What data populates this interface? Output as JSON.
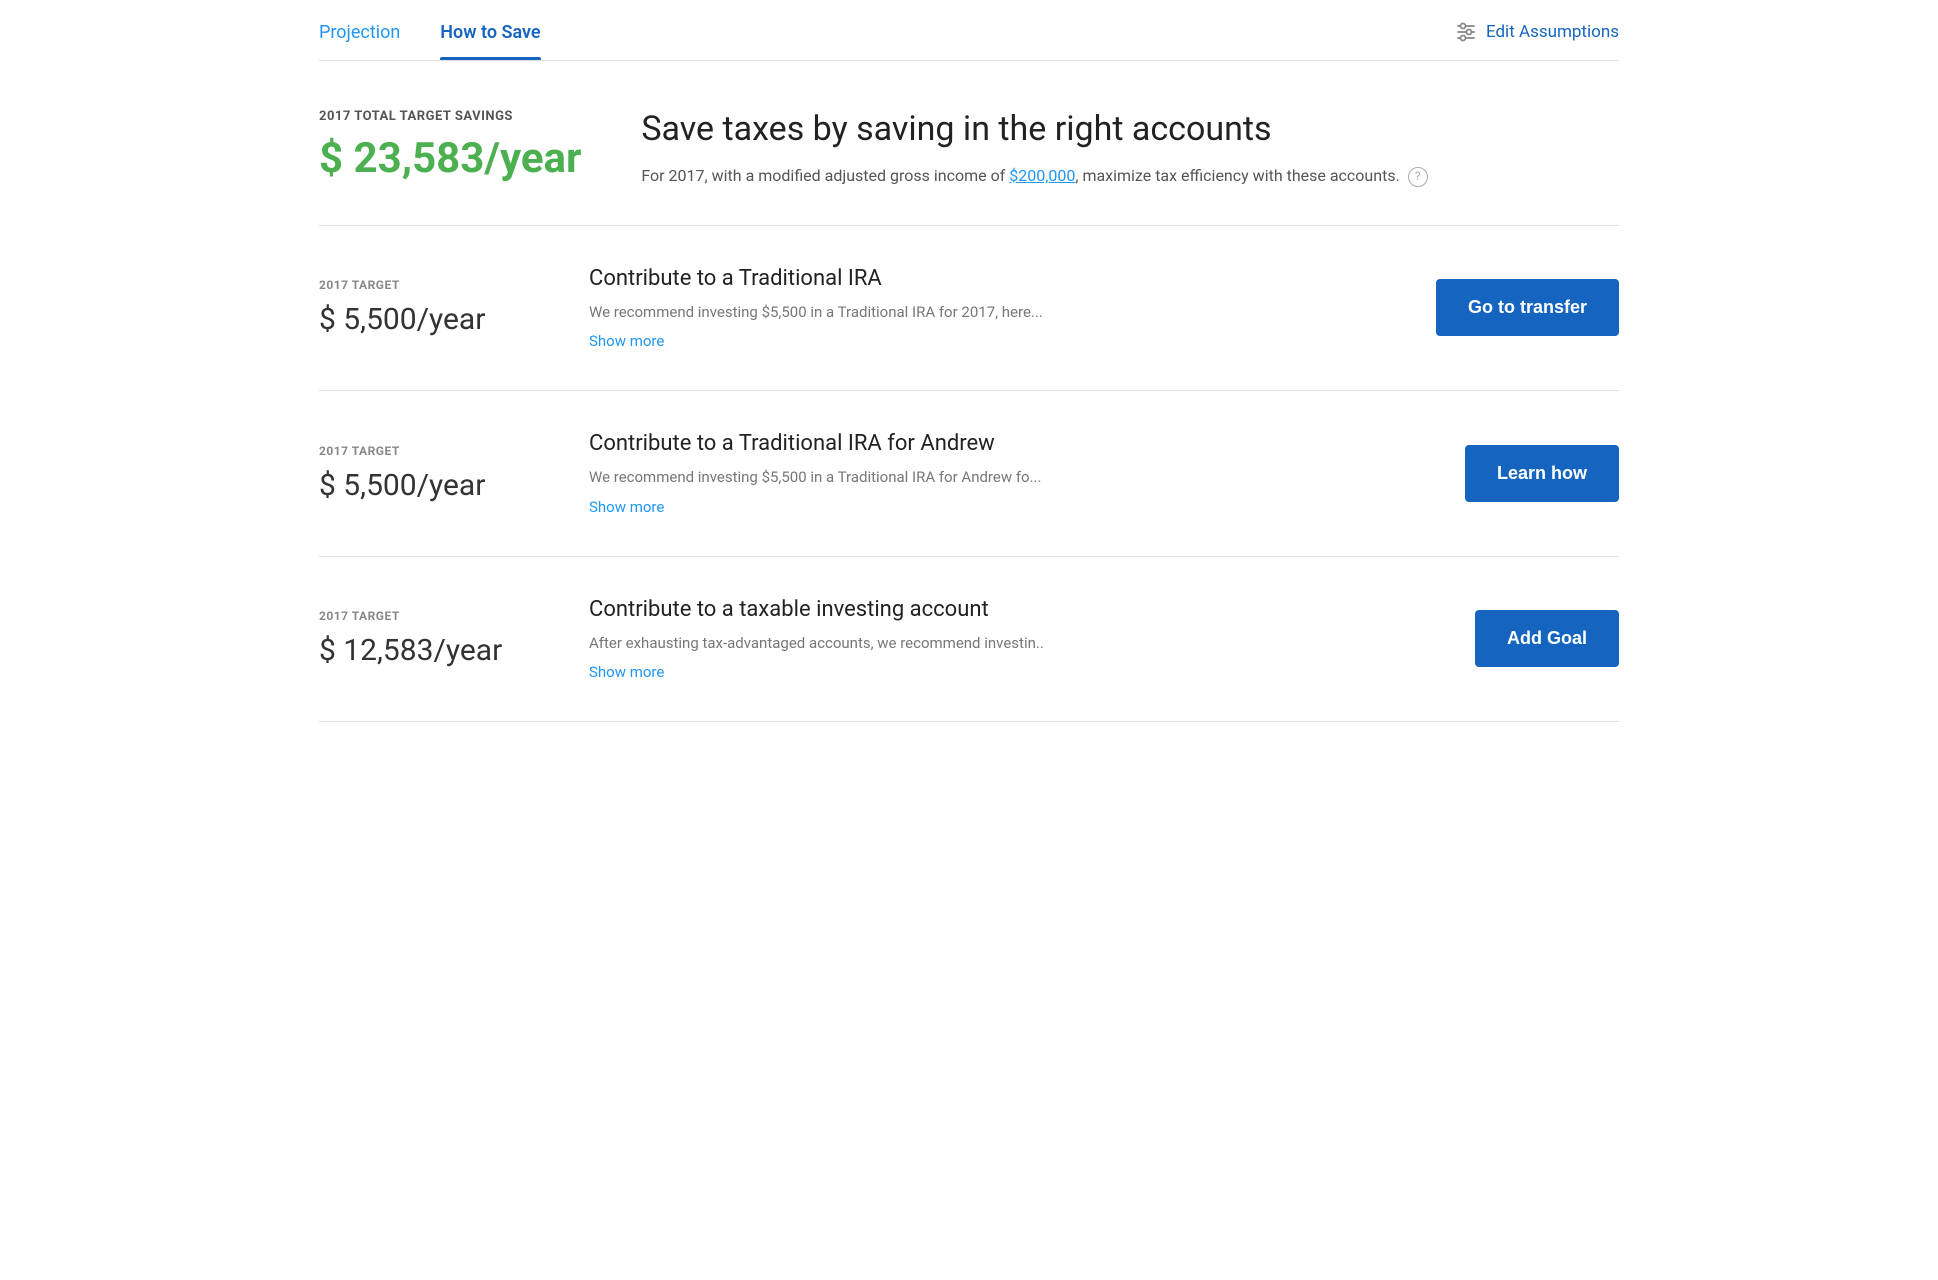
{
  "tabs": {
    "projection": {
      "label": "Projection",
      "active": false
    },
    "how_to_save": {
      "label": "How to Save",
      "active": true
    }
  },
  "header": {
    "edit_assumptions_label": "Edit Assumptions"
  },
  "hero": {
    "label": "2017 TOTAL TARGET SAVINGS",
    "amount": "$ 23,583/year",
    "title": "Save taxes by saving in the right accounts",
    "description_pre": "For 2017, with a modified adjusted gross income of ",
    "income_link": "$200,000",
    "description_post": ", maximize tax efficiency with these accounts.",
    "info_icon": "?"
  },
  "recommendations": [
    {
      "year_label": "2017 TARGET",
      "amount": "$ 5,500/year",
      "title": "Contribute to a Traditional IRA",
      "description": "We recommend investing $5,500 in a Traditional IRA for 2017, here...",
      "show_more": "Show more",
      "action_label": "Go to transfer"
    },
    {
      "year_label": "2017 TARGET",
      "amount": "$ 5,500/year",
      "title": "Contribute to a Traditional IRA for Andrew",
      "description": "We recommend investing $5,500 in a Traditional IRA for Andrew fo...",
      "show_more": "Show more",
      "action_label": "Learn how"
    },
    {
      "year_label": "2017 TARGET",
      "amount": "$ 12,583/year",
      "title": "Contribute to a taxable investing account",
      "description": "After exhausting tax-advantaged accounts, we recommend investin..",
      "show_more": "Show more",
      "action_label": "Add Goal"
    }
  ]
}
